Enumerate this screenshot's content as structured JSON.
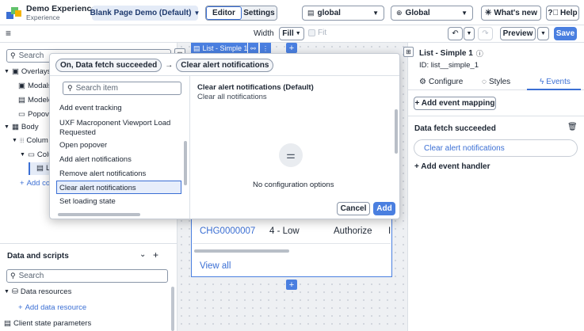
{
  "app": {
    "name": "Demo Experience",
    "subtitle": "Experience",
    "page_select": "Blank Page Demo (Default)"
  },
  "header": {
    "editor_tab": "Editor",
    "settings_tab": "Settings",
    "scope_select": "global",
    "global_select": "Global",
    "whats_new": "What's new",
    "help": "Help"
  },
  "subbar": {
    "menu_icon": "≡",
    "width_label": "Width",
    "width_value": "Fill",
    "fit_label": "Fit",
    "preview": "Preview",
    "save": "Save"
  },
  "left": {
    "search_placeholder": "Search",
    "overlays": "Overlays",
    "modals": "Modals",
    "modeless": "Modele",
    "popovers": "Popove",
    "body": "Body",
    "columns": "Colum",
    "column": "Colu",
    "list_item": "L",
    "add_content": "Add co",
    "data_scripts_title": "Data and scripts",
    "data_search_placeholder": "Search",
    "data_resources": "Data resources",
    "add_data_resource": "Add data resource",
    "client_state": "Client state parameters"
  },
  "popup": {
    "breadcrumb_event": "On, Data fetch succeeded",
    "breadcrumb_arrow": "→",
    "breadcrumb_action": "Clear alert notifications",
    "search_placeholder": "Search item",
    "items": [
      "Add event tracking",
      "UXF Macroponent Viewport Load Requested",
      "Open popover",
      "Add alert notifications",
      "Remove alert notifications",
      "Clear alert notifications",
      "Set loading state"
    ],
    "selected_index": 5,
    "detail_title": "Clear alert notifications (Default)",
    "detail_subtitle": "Clear all notifications",
    "no_config": "No configuration options",
    "cancel": "Cancel",
    "add": "Add"
  },
  "canvas": {
    "list_tag": "List - Simple 1",
    "row": {
      "number": "CHG0000007",
      "priority": "4 - Low",
      "state": "Authorize",
      "extra": "I"
    },
    "view_all": "View all",
    "plus": "+"
  },
  "right": {
    "title": "List - Simple 1",
    "id_label": "ID: list__simple_1",
    "tabs": {
      "configure": "Configure",
      "styles": "Styles",
      "events": "Events"
    },
    "add_mapping": "+ Add event mapping",
    "event_name": "Data fetch succeeded",
    "event_action": "Clear alert notifications",
    "add_handler": "+ Add event handler"
  },
  "colors": {
    "accent": "#3b6fd4",
    "save": "#4a7fe0",
    "selected_bg": "#e7eefb",
    "tag_blue": "#4a7fe0"
  }
}
